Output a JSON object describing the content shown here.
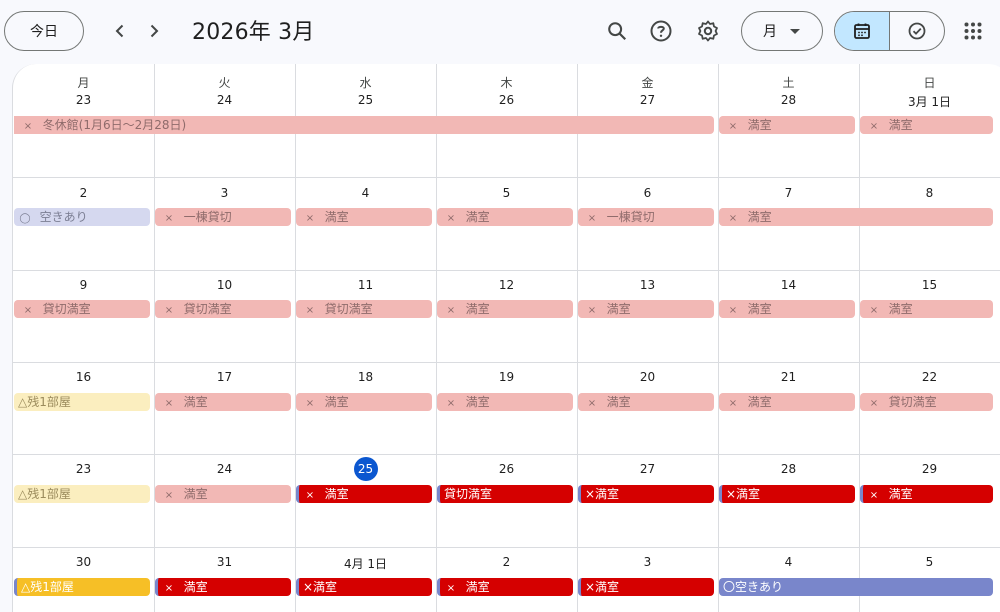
{
  "header": {
    "today_label": "今日",
    "title": "2026年 3月",
    "view_label": "月"
  },
  "weekdays": [
    "月",
    "火",
    "水",
    "木",
    "金",
    "土",
    "日"
  ],
  "weeks": [
    [
      "23",
      "24",
      "25",
      "26",
      "27",
      "28",
      "3月 1日"
    ],
    [
      "2",
      "3",
      "4",
      "5",
      "6",
      "7",
      "8"
    ],
    [
      "9",
      "10",
      "11",
      "12",
      "13",
      "14",
      "15"
    ],
    [
      "16",
      "17",
      "18",
      "19",
      "20",
      "21",
      "22"
    ],
    [
      "23",
      "24",
      "25",
      "26",
      "27",
      "28",
      "29"
    ],
    [
      "30",
      "31",
      "4月 1日",
      "2",
      "3",
      "4",
      "5"
    ]
  ],
  "today": {
    "week": 4,
    "day": 2
  },
  "events": [
    {
      "week": 0,
      "day": 0,
      "span": 5,
      "mark": "×",
      "text": "冬休館(1月6日〜2月28日)",
      "style": "pink",
      "cont": true
    },
    {
      "week": 0,
      "day": 5,
      "span": 1,
      "mark": "×",
      "text": "満室",
      "style": "pink"
    },
    {
      "week": 0,
      "day": 6,
      "span": 1,
      "mark": "×",
      "text": "満室",
      "style": "pink"
    },
    {
      "week": 1,
      "day": 0,
      "span": 1,
      "mark": "◯",
      "text": "空きあり",
      "style": "lav"
    },
    {
      "week": 1,
      "day": 1,
      "span": 1,
      "mark": "×",
      "text": "一棟貸切",
      "style": "pink"
    },
    {
      "week": 1,
      "day": 2,
      "span": 1,
      "mark": "×",
      "text": "満室",
      "style": "pink"
    },
    {
      "week": 1,
      "day": 3,
      "span": 1,
      "mark": "×",
      "text": "満室",
      "style": "pink"
    },
    {
      "week": 1,
      "day": 4,
      "span": 1,
      "mark": "×",
      "text": "一棟貸切",
      "style": "pink"
    },
    {
      "week": 1,
      "day": 5,
      "span": 2,
      "mark": "×",
      "text": "満室",
      "style": "pink"
    },
    {
      "week": 2,
      "day": 0,
      "span": 1,
      "mark": "×",
      "text": "貸切満室",
      "style": "pink"
    },
    {
      "week": 2,
      "day": 1,
      "span": 1,
      "mark": "×",
      "text": "貸切満室",
      "style": "pink"
    },
    {
      "week": 2,
      "day": 2,
      "span": 1,
      "mark": "×",
      "text": "貸切満室",
      "style": "pink"
    },
    {
      "week": 2,
      "day": 3,
      "span": 1,
      "mark": "×",
      "text": "満室",
      "style": "pink"
    },
    {
      "week": 2,
      "day": 4,
      "span": 1,
      "mark": "×",
      "text": "満室",
      "style": "pink"
    },
    {
      "week": 2,
      "day": 5,
      "span": 1,
      "mark": "×",
      "text": "満室",
      "style": "pink"
    },
    {
      "week": 2,
      "day": 6,
      "span": 1,
      "mark": "×",
      "text": "満室",
      "style": "pink"
    },
    {
      "week": 3,
      "day": 0,
      "span": 1,
      "mark": "",
      "text": "△残1部屋",
      "style": "yellow"
    },
    {
      "week": 3,
      "day": 1,
      "span": 1,
      "mark": "×",
      "text": "満室",
      "style": "pink"
    },
    {
      "week": 3,
      "day": 2,
      "span": 1,
      "mark": "×",
      "text": "満室",
      "style": "pink"
    },
    {
      "week": 3,
      "day": 3,
      "span": 1,
      "mark": "×",
      "text": "満室",
      "style": "pink"
    },
    {
      "week": 3,
      "day": 4,
      "span": 1,
      "mark": "×",
      "text": "満室",
      "style": "pink"
    },
    {
      "week": 3,
      "day": 5,
      "span": 1,
      "mark": "×",
      "text": "満室",
      "style": "pink"
    },
    {
      "week": 3,
      "day": 6,
      "span": 1,
      "mark": "×",
      "text": "貸切満室",
      "style": "pink"
    },
    {
      "week": 4,
      "day": 0,
      "span": 1,
      "mark": "",
      "text": "△残1部屋",
      "style": "yellow"
    },
    {
      "week": 4,
      "day": 1,
      "span": 1,
      "mark": "×",
      "text": "満室",
      "style": "pink"
    },
    {
      "week": 4,
      "day": 2,
      "span": 1,
      "mark": "×",
      "text": "満室",
      "style": "red"
    },
    {
      "week": 4,
      "day": 3,
      "span": 1,
      "mark": "",
      "text": "貸切満室",
      "style": "red"
    },
    {
      "week": 4,
      "day": 4,
      "span": 1,
      "mark": "",
      "text": "×満室",
      "style": "red"
    },
    {
      "week": 4,
      "day": 5,
      "span": 1,
      "mark": "",
      "text": "×満室",
      "style": "red"
    },
    {
      "week": 4,
      "day": 6,
      "span": 1,
      "mark": "×",
      "text": "満室",
      "style": "red"
    },
    {
      "week": 5,
      "day": 0,
      "span": 1,
      "mark": "",
      "text": "△残1部屋",
      "style": "gold"
    },
    {
      "week": 5,
      "day": 1,
      "span": 1,
      "mark": "×",
      "text": "満室",
      "style": "red"
    },
    {
      "week": 5,
      "day": 2,
      "span": 1,
      "mark": "",
      "text": "×満室",
      "style": "red"
    },
    {
      "week": 5,
      "day": 3,
      "span": 1,
      "mark": "×",
      "text": "満室",
      "style": "red"
    },
    {
      "week": 5,
      "day": 4,
      "span": 1,
      "mark": "",
      "text": "×満室",
      "style": "red"
    },
    {
      "week": 5,
      "day": 5,
      "span": 2,
      "mark": "",
      "text": "〇空きあり",
      "style": "blue"
    }
  ],
  "colors": {
    "accent": "#0b57d0",
    "segment_active": "#c2e7ff",
    "event_red": "#d50000",
    "event_pink": "#f2b8b5",
    "event_gold": "#f6bf26",
    "event_blue": "#7986cb"
  }
}
